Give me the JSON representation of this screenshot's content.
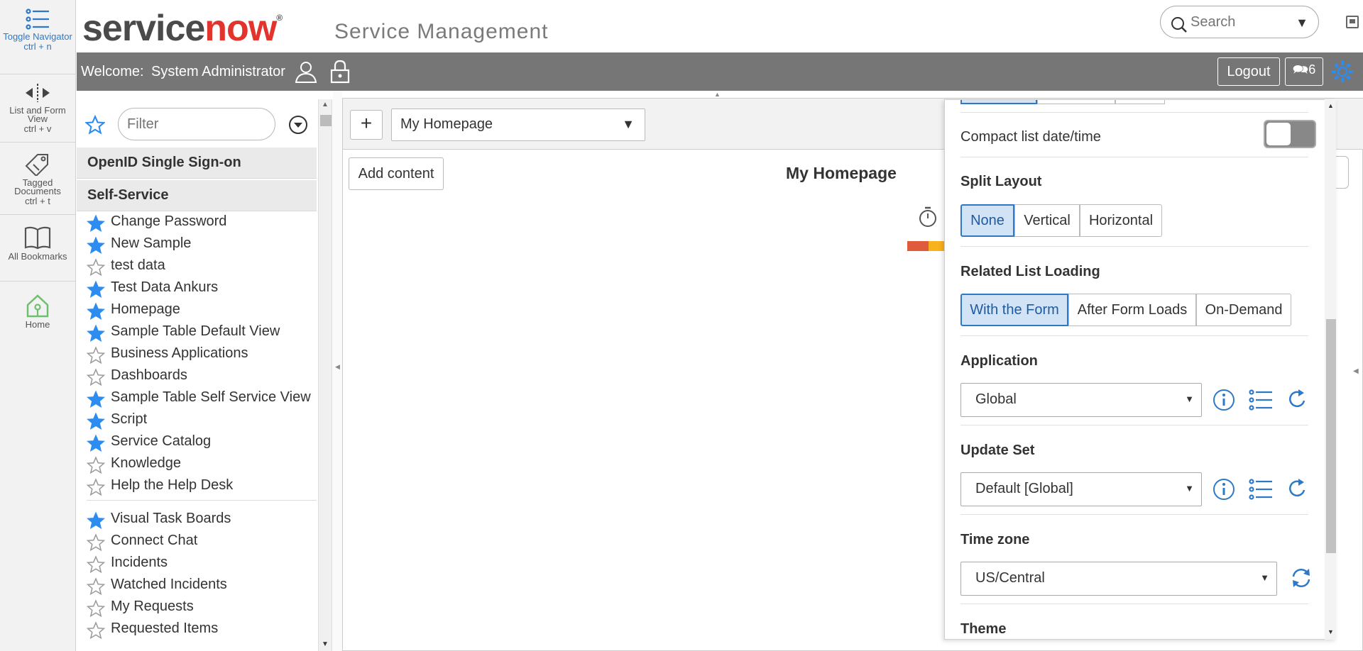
{
  "rail": {
    "toggle_navigator": {
      "label": "Toggle Navigator",
      "shortcut": "ctrl + n"
    },
    "list_form_view": {
      "label": "List and Form View",
      "shortcut": "ctrl + v"
    },
    "tagged_documents": {
      "label": "Tagged Documents",
      "shortcut": "ctrl + t"
    },
    "all_bookmarks": {
      "label": "All Bookmarks"
    },
    "home": {
      "label": "Home"
    }
  },
  "banner": {
    "logo_service": "service",
    "logo_now": "now",
    "app_title": "Service Management",
    "search_placeholder": "Search"
  },
  "topbar": {
    "welcome": "Welcome:",
    "user_name": "System Administrator",
    "logout": "Logout",
    "connect_count": "6"
  },
  "navigator": {
    "filter_placeholder": "Filter",
    "sections": [
      "OpenID Single Sign-on",
      "Self-Service"
    ],
    "items": [
      {
        "label": "Change Password",
        "fav": true
      },
      {
        "label": "New Sample",
        "fav": true
      },
      {
        "label": "test data",
        "fav": false
      },
      {
        "label": "Test Data Ankurs",
        "fav": true
      },
      {
        "label": "Homepage",
        "fav": true
      },
      {
        "label": "Sample Table Default View",
        "fav": true
      },
      {
        "label": "Business Applications",
        "fav": false
      },
      {
        "label": "Dashboards",
        "fav": false
      },
      {
        "label": "Sample Table Self Service View",
        "fav": true
      },
      {
        "label": "Script",
        "fav": true
      },
      {
        "label": "Service Catalog",
        "fav": true
      },
      {
        "label": "Knowledge",
        "fav": false
      },
      {
        "label": "Help the Help Desk",
        "fav": false
      },
      {
        "label": "Visual Task Boards",
        "fav": true
      },
      {
        "label": "Connect Chat",
        "fav": false
      },
      {
        "label": "Incidents",
        "fav": false
      },
      {
        "label": "Watched Incidents",
        "fav": false
      },
      {
        "label": "My Requests",
        "fav": false
      },
      {
        "label": "Requested Items",
        "fav": false
      }
    ]
  },
  "main": {
    "homepage_select": "My Homepage",
    "add_content": "Add content",
    "title": "My Homepage"
  },
  "panel": {
    "compact_list_label": "Compact list date/time",
    "split_layout": {
      "label": "Split Layout",
      "options": [
        "None",
        "Vertical",
        "Horizontal"
      ],
      "selected": "None"
    },
    "related_list": {
      "label": "Related List Loading",
      "options": [
        "With the Form",
        "After Form Loads",
        "On-Demand"
      ],
      "selected": "With the Form"
    },
    "application": {
      "label": "Application",
      "value": "Global"
    },
    "update_set": {
      "label": "Update Set",
      "value": "Default [Global]"
    },
    "time_zone": {
      "label": "Time zone",
      "value": "US/Central"
    },
    "theme": {
      "label": "Theme"
    }
  },
  "colors": {
    "accent": "#2d79c7",
    "star_fav": "#2d8cf0",
    "topbar": "#767676",
    "logo_now": "#e2342c",
    "home_icon": "#6fbf6f"
  }
}
